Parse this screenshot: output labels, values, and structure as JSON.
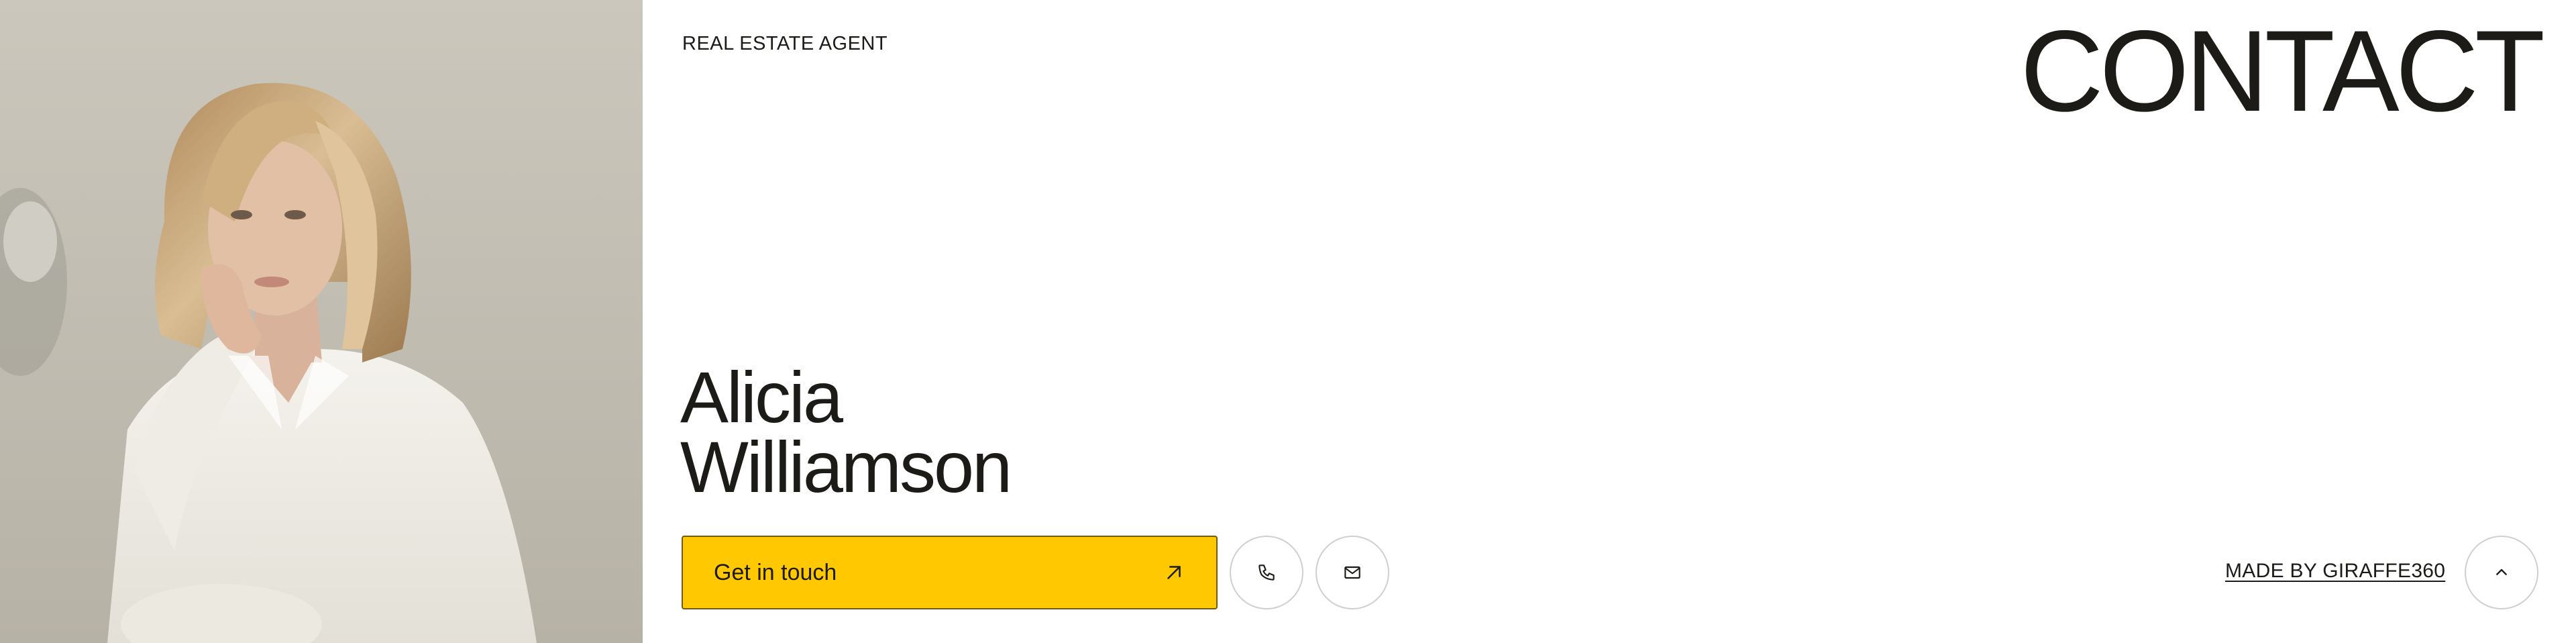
{
  "profile": {
    "role": "REAL ESTATE AGENT",
    "first_name": "Alicia",
    "last_name": "Williamson"
  },
  "header": {
    "title": "CONTACT"
  },
  "actions": {
    "cta_label": "Get in touch",
    "cta_icon": "arrow-up-right-icon",
    "phone_icon": "phone-icon",
    "mail_icon": "mail-icon"
  },
  "footer": {
    "made_by": "MADE BY GIRAFFE360",
    "scroll_top_icon": "chevron-up-icon"
  },
  "colors": {
    "accent": "#ffc800",
    "text": "#1c1b17",
    "background": "#ffffff"
  }
}
